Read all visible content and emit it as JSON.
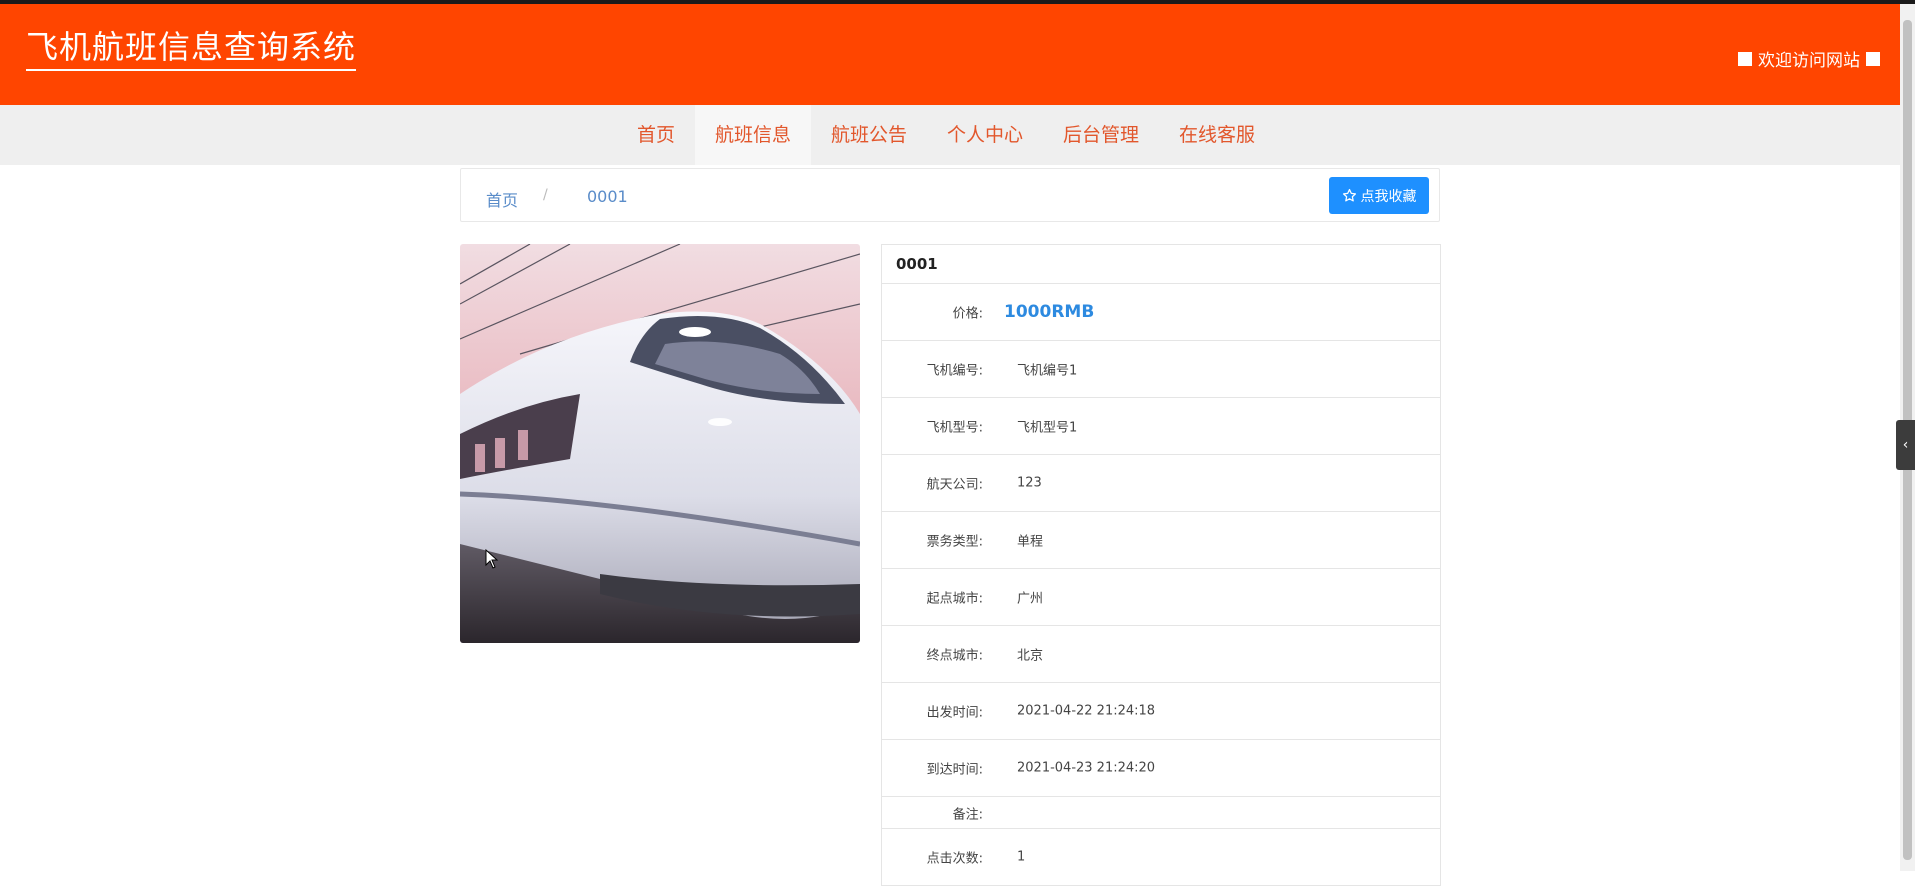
{
  "header": {
    "site_title": "飞机航班信息查询系统",
    "welcome_text": "欢迎访问网站"
  },
  "nav": {
    "items": [
      {
        "label": "首页"
      },
      {
        "label": "航班信息",
        "active": true
      },
      {
        "label": "航班公告"
      },
      {
        "label": "个人中心"
      },
      {
        "label": "后台管理"
      },
      {
        "label": "在线客服"
      }
    ]
  },
  "breadcrumb": {
    "home": "首页",
    "separator": "/",
    "current": "0001",
    "favorite_button": "点我收藏"
  },
  "detail": {
    "title": "0001",
    "price_label": "价格:",
    "price_value": "1000RMB",
    "fields": [
      {
        "label": "飞机编号:",
        "value": "飞机编号1"
      },
      {
        "label": "飞机型号:",
        "value": "飞机型号1"
      },
      {
        "label": "航天公司:",
        "value": "123"
      },
      {
        "label": "票务类型:",
        "value": "单程"
      },
      {
        "label": "起点城市:",
        "value": "广州"
      },
      {
        "label": "终点城市:",
        "value": "北京"
      },
      {
        "label": "出发时间:",
        "value": "2021-04-22 21:24:18"
      },
      {
        "label": "到达时间:",
        "value": "2021-04-23 21:24:20"
      }
    ],
    "remark_label": "备注:",
    "remark_value": "",
    "clicks_label": "点击次数:",
    "clicks_value": "1"
  },
  "colors": {
    "header_bg": "#ff4500",
    "nav_text": "#e2572c",
    "price": "#2d8ae0",
    "button": "#1e90ff"
  }
}
